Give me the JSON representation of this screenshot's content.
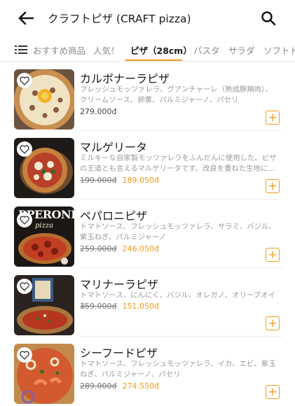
{
  "header": {
    "title": "クラフトピザ (CRAFT pizza)",
    "back_icon": "arrow-left-icon",
    "search_icon": "search-icon"
  },
  "tabs": [
    {
      "label": "おすすめ商品",
      "active": false
    },
    {
      "label": "人気！",
      "active": false
    },
    {
      "label": "ピザ（28cm）",
      "active": true
    },
    {
      "label": "パスタ",
      "active": false
    },
    {
      "label": "サラダ",
      "active": false
    },
    {
      "label": "ソフトドリ",
      "active": false
    }
  ],
  "accent_color": "#f29a1c",
  "products": [
    {
      "name": "カルボナーラピザ",
      "description": "フレッシュモッツァレラ、グアンチャーレ（熟成豚頬肉）、クリームソース、卵黄、パルミジャーノ、パセリ",
      "price_old": "",
      "price": "279.000đ"
    },
    {
      "name": "マルゲリータ",
      "description": "ミルキーな自家製モッツァレラをふんだんに使用した、ピザの王道とも言えるマルゲリータです。改良を重ねた生地に、イタリ…",
      "price_old": "199.000đ",
      "price": "189.050đ"
    },
    {
      "name": "ペパロニピザ",
      "description": "トマトソース、フレッシュモッツァレラ、サラミ、バジル、紫玉ねぎ、パルミジャーノ",
      "price_old": "259.000đ",
      "price": "246.050đ",
      "image_text": "PPERONI",
      "image_subtext": "pizza"
    },
    {
      "name": "マリナーラピザ",
      "description": "トマトソース、にんにく、バジル、オレガノ、オリーブオイル",
      "price_old": "159.000đ",
      "price": "151.050đ"
    },
    {
      "name": "シーフードピザ",
      "description": "トマトソース、フレッシュモッツァレラ、イカ、エビ、紫玉ねぎ、パルミジャーノ、パセリ",
      "price_old": "289.000đ",
      "price": "274.550đ"
    }
  ],
  "add_label": "+"
}
